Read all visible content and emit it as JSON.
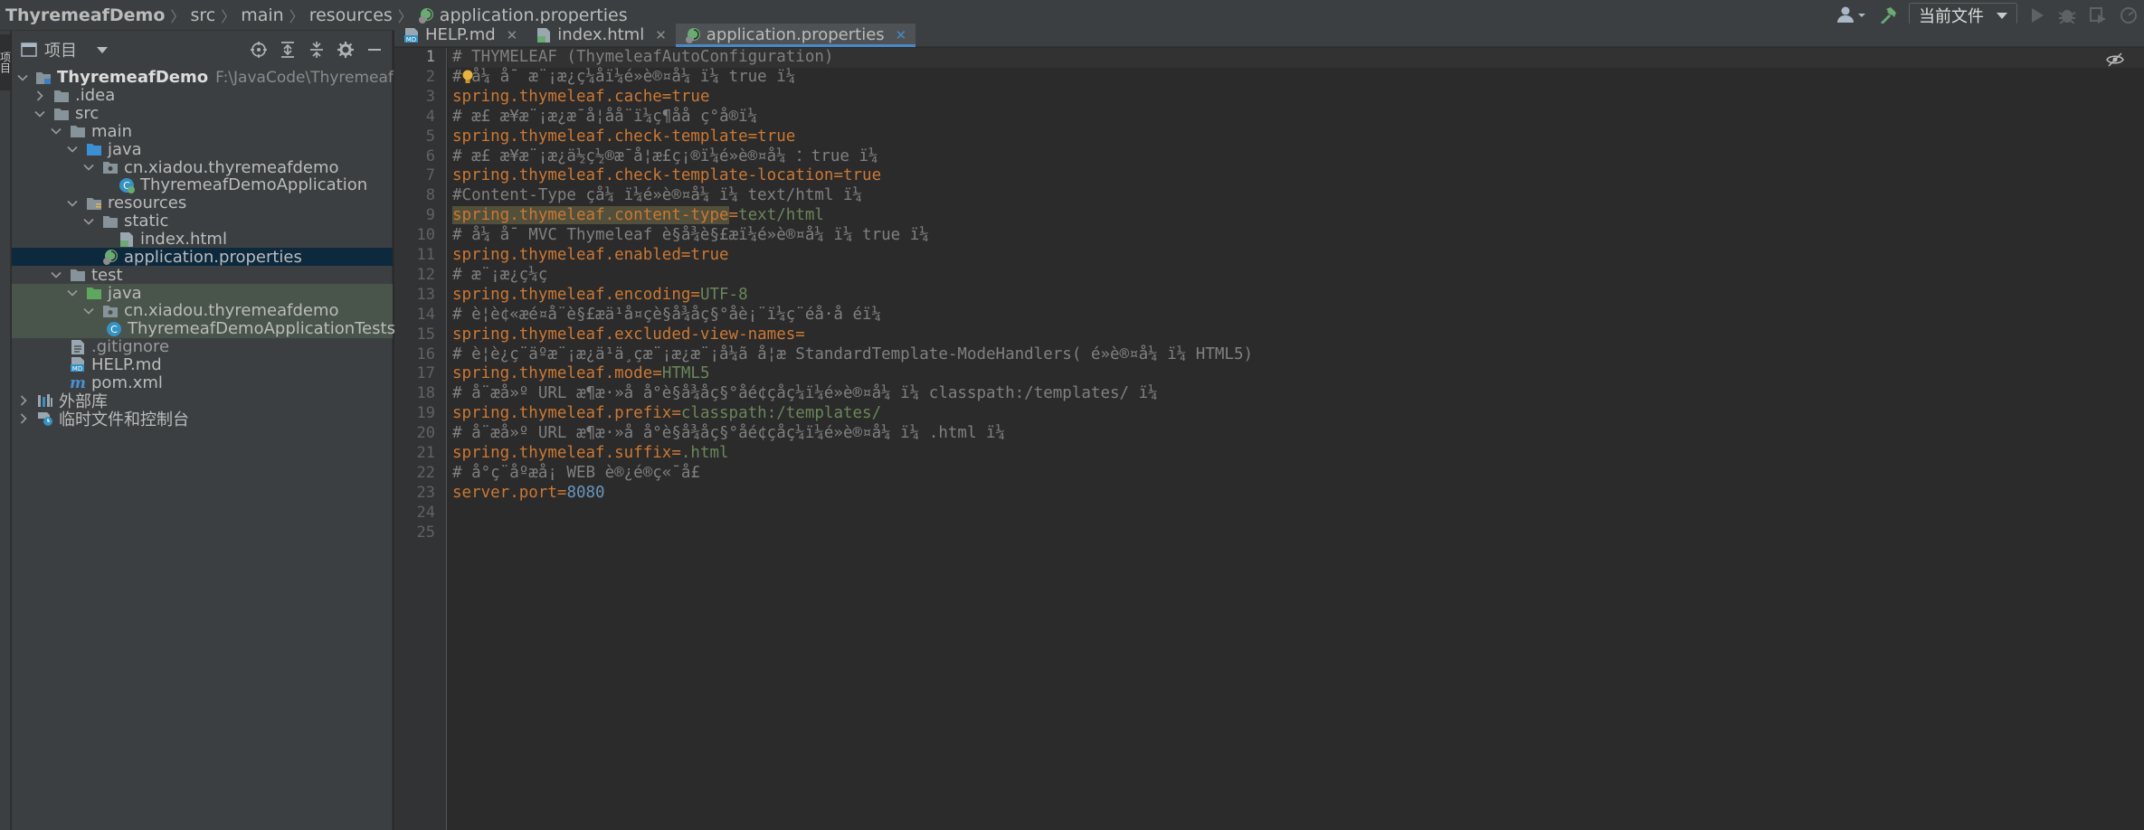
{
  "breadcrumbs": [
    "ThyremeafDemo",
    "src",
    "main",
    "resources",
    "application.properties"
  ],
  "toolbar": {
    "run_config_label": "当前文件"
  },
  "left_strip": {
    "tab_label": "项目"
  },
  "project_panel": {
    "title": "项目",
    "tree": [
      {
        "label": "ThyremeafDemo",
        "path": "F:\\JavaCode\\ThyremeafDemo",
        "icon": "module-folder-icon"
      },
      {
        "label": ".idea",
        "icon": "folder-icon"
      },
      {
        "label": "src",
        "icon": "folder-icon"
      },
      {
        "label": "main",
        "icon": "folder-icon"
      },
      {
        "label": "java",
        "icon": "source-folder-icon"
      },
      {
        "label": "cn.xiadou.thyremeafdemo",
        "icon": "package-icon"
      },
      {
        "label": "ThyremeafDemoApplication",
        "icon": "spring-class-icon"
      },
      {
        "label": "resources",
        "icon": "resources-folder-icon"
      },
      {
        "label": "static",
        "icon": "folder-icon"
      },
      {
        "label": "index.html",
        "icon": "html-file-icon"
      },
      {
        "label": "application.properties",
        "icon": "properties-file-icon"
      },
      {
        "label": "test",
        "icon": "folder-icon"
      },
      {
        "label": "java",
        "icon": "test-source-folder-icon"
      },
      {
        "label": "cn.xiadou.thyremeafdemo",
        "icon": "package-icon"
      },
      {
        "label": "ThyremeafDemoApplicationTests",
        "icon": "class-icon"
      },
      {
        "label": ".gitignore",
        "icon": "text-file-icon"
      },
      {
        "label": "HELP.md",
        "icon": "markdown-file-icon"
      },
      {
        "label": "pom.xml",
        "icon": "maven-file-icon"
      },
      {
        "label": "外部库",
        "icon": "library-icon"
      },
      {
        "label": "临时文件和控制台",
        "icon": "scratch-icon"
      }
    ]
  },
  "tabs": [
    {
      "label": "HELP.md",
      "icon": "markdown-file-icon",
      "active": false
    },
    {
      "label": "index.html",
      "icon": "html-file-icon",
      "active": false
    },
    {
      "label": "application.properties",
      "icon": "properties-file-icon",
      "active": true
    }
  ],
  "editor": {
    "current_line": 1,
    "lines": [
      {
        "n": "1",
        "comment": "# THYMELEAF (ThymeleafAutoConfiguration)"
      },
      {
        "n": "2",
        "comment": "# å¼ å¯ æ¨¡æ¿ç¼å­ï¼é»è®¤å¼ ï¼ true ï¼"
      },
      {
        "n": "3",
        "key": "spring.thymeleaf.cache",
        "value": "true",
        "vtype": "kw"
      },
      {
        "n": "4",
        "comment": "# æ£ æ¥æ¨¡æ¿æ¯å¦å­å¨ï¼ç¶ååç°å®ï¼"
      },
      {
        "n": "5",
        "key": "spring.thymeleaf.check-template",
        "value": "true",
        "vtype": "kw"
      },
      {
        "n": "6",
        "comment": "# æ£ æ¥æ¨¡æ¿ä½ç½®æ¯å¦æ­£ç¡®ï¼é»è®¤å¼ ：true ï¼"
      },
      {
        "n": "7",
        "key": "spring.thymeleaf.check-template-location",
        "value": "true",
        "vtype": "kw"
      },
      {
        "n": "8",
        "comment": "#Content-Type çå¼ ï¼é»è®¤å¼ ï¼ text/html ï¼"
      },
      {
        "n": "9",
        "key": "spring.thymeleaf.content-type",
        "value": "text/html",
        "vtype": "str",
        "highlight": true
      },
      {
        "n": "10",
        "comment": "# å¼ å¯ MVC Thymeleaf è§å¾è§£æï¼é»è®¤å¼ ï¼ true ï¼"
      },
      {
        "n": "11",
        "key": "spring.thymeleaf.enabled",
        "value": "true",
        "vtype": "kw"
      },
      {
        "n": "12",
        "comment": "# æ¨¡æ¿ç¼ç "
      },
      {
        "n": "13",
        "key": "spring.thymeleaf.encoding",
        "value": "UTF-8",
        "vtype": "str"
      },
      {
        "n": "14",
        "comment": "# è¦è¢«æé¤å¨è§£æä¹å¤çè§å¾åç§°åè¡¨ï¼ç¨éå·å éï¼"
      },
      {
        "n": "15",
        "key": "spring.thymeleaf.excluded-view-names",
        "value": "",
        "vtype": "str"
      },
      {
        "n": "16",
        "comment": "# è¦è¿ç¨äºæ¨¡æ¿ä¹ä¸çæ¨¡æ¿æ¨¡å¼ã å¦æ StandardTemplate-ModeHandlers( é»è®¤å¼ ï¼ HTML5)"
      },
      {
        "n": "17",
        "key": "spring.thymeleaf.mode",
        "value": "HTML5",
        "vtype": "str"
      },
      {
        "n": "18",
        "comment": "# å¨æå»º URL æ¶æ·»å å°è§å¾åç§°åé¢çåç¼ï¼é»è®¤å¼ ï¼ classpath:/templates/ ï¼"
      },
      {
        "n": "19",
        "key": "spring.thymeleaf.prefix",
        "value": "classpath:/templates/",
        "vtype": "str"
      },
      {
        "n": "20",
        "comment": "# å¨æå»º URL æ¶æ·»å å°è§å¾åç§°åé¢çåç¼ï¼é»è®¤å¼ ï¼ .html ï¼"
      },
      {
        "n": "21",
        "key": "spring.thymeleaf.suffix",
        "value": ".html",
        "vtype": "str"
      },
      {
        "n": "22",
        "comment": "# å°ç¨åºæå¡ WEB è®¿é®ç«¯å£"
      },
      {
        "n": "23",
        "key": "server.port",
        "value": "8080",
        "vtype": "num"
      },
      {
        "n": "24"
      },
      {
        "n": "25"
      }
    ]
  },
  "colors": {
    "accent": "#4a88c7",
    "key": "#cc7832",
    "string": "#6a8759",
    "number": "#6897bb",
    "comment": "#808080",
    "selection": "#0d293e"
  }
}
